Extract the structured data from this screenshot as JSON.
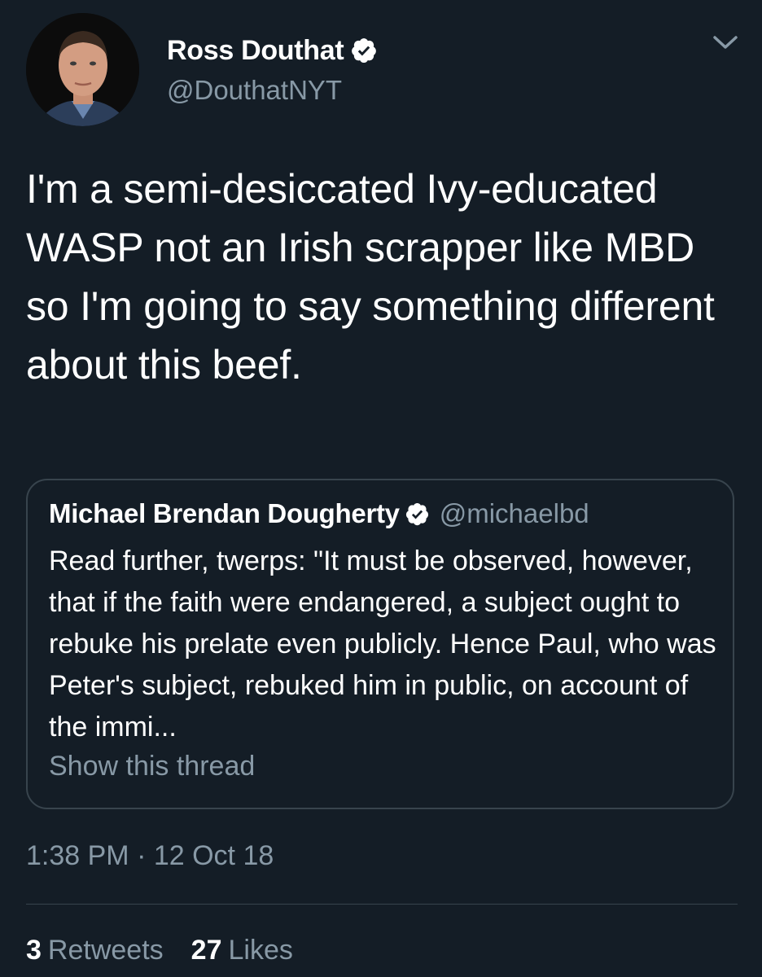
{
  "tweet": {
    "author": {
      "name": "Ross Douthat",
      "handle": "@DouthatNYT",
      "verified": true
    },
    "text": "I'm a semi-desiccated Ivy-educated WASP not an Irish scrapper like MBD so I'm going to say something different about this beef.",
    "quoted": {
      "name": "Michael Brendan Dougherty",
      "handle": "@michaelbd",
      "verified": true,
      "text": "Read further, twerps: \"It must be observed, however, that if the faith were endangered, a subject ought to rebuke his prelate even publicly. Hence Paul, who was Peter's subject, rebuked him in public, on account of the immi...",
      "show_thread": "Show this thread"
    },
    "timestamp": "1:38 PM · 12 Oct 18",
    "retweets": {
      "count": "3",
      "label": "Retweets"
    },
    "likes": {
      "count": "27",
      "label": "Likes"
    }
  },
  "icons": {
    "verified": "verified-badge-icon",
    "menu": "chevron-down-icon"
  },
  "colors": {
    "background": "#141d26",
    "secondary_text": "#8899a6",
    "border": "#38444d",
    "primary_text": "#ffffff"
  }
}
